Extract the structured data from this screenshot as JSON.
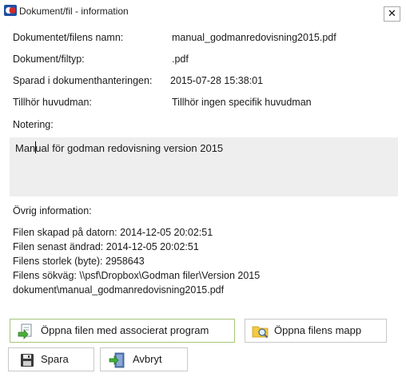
{
  "window": {
    "title": "Dokument/fil - information",
    "close_glyph": "✕"
  },
  "fields": {
    "name_label": "Dokumentet/filens namn:",
    "name_value": "manual_godmanredovisning2015.pdf",
    "type_label": "Dokument/filtyp:",
    "type_value": ".pdf",
    "saved_label": "Sparad i dokumenthanteringen:",
    "saved_value": "2015-07-28 15:38:01",
    "principal_label": "Tillhör huvudman:",
    "principal_value": "Tillhör ingen specifik huvudman",
    "note_label": "Notering:",
    "note_value": "Manual för godman redovisning version 2015"
  },
  "other": {
    "heading": "Övrig information:",
    "created": "Filen skapad på datorn: 2014-12-05  20:02:51",
    "modified": "Filen senast ändrad: 2014-12-05  20:02:51",
    "size": "Filens storlek (byte): 2958643",
    "path_line1": "Filens sökväg: \\\\psf\\Dropbox\\Godman filer\\Version 2015",
    "path_line2": "dokument\\manual_godmanredovisning2015.pdf"
  },
  "buttons": {
    "open_file": "Öppna filen med associerat program",
    "open_folder": "Öppna filens mapp",
    "save": "Spara",
    "cancel": "Avbryt"
  },
  "icons": {
    "app": "app-logo-icon",
    "open_file": "open-file-icon",
    "open_folder": "folder-search-icon",
    "save": "floppy-disk-icon",
    "cancel": "exit-door-icon"
  },
  "colors": {
    "note_bg": "#eeeeee",
    "primary_border": "#a6c57a"
  }
}
